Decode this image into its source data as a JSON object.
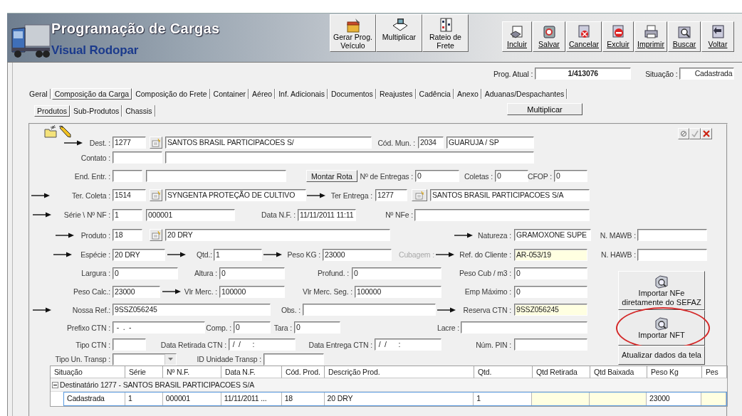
{
  "window": {
    "title": "Programação de Cargas",
    "subtitle": "Visual Rodopar"
  },
  "toolbar_left": [
    {
      "label": "Gerar Prog. Veículo",
      "kind": "generate"
    },
    {
      "label": "Multiplicar",
      "kind": "multiply"
    },
    {
      "label": "Rateio de Frete",
      "kind": "split"
    }
  ],
  "toolbar_right": [
    {
      "label": "Incluir",
      "kind": "insert"
    },
    {
      "label": "Salvar",
      "kind": "save"
    },
    {
      "label": "Cancelar",
      "kind": "cancel"
    },
    {
      "label": "Excluir",
      "kind": "delete"
    },
    {
      "label": "Imprimir",
      "kind": "print"
    },
    {
      "label": "Buscar",
      "kind": "search"
    },
    {
      "label": "Voltar",
      "kind": "back"
    }
  ],
  "record": {
    "prog_label": "Prog. Atual :",
    "prog_value": "1/413076",
    "status_label": "Situação :",
    "status_value": "Cadastrada"
  },
  "tabs": [
    {
      "label": "Geral",
      "selected": false
    },
    {
      "label": "Composição da Carga",
      "selected": true
    },
    {
      "label": "Composição do Frete",
      "selected": false
    },
    {
      "label": "Container",
      "selected": false
    },
    {
      "label": "Aéreo",
      "selected": false
    },
    {
      "label": "Inf. Adicionais",
      "selected": false
    },
    {
      "label": "Documentos",
      "selected": false
    },
    {
      "label": "Reajustes",
      "selected": false
    },
    {
      "label": "Cadência",
      "selected": false
    },
    {
      "label": "Anexo",
      "selected": false
    },
    {
      "label": "Aduanas/Despachantes",
      "selected": false
    }
  ],
  "subtabs": [
    {
      "label": "Produtos",
      "selected": true
    },
    {
      "label": "Sub-Produtos",
      "selected": false
    },
    {
      "label": "Chassis",
      "selected": false
    }
  ],
  "multiply_button": "Multiplicar",
  "form_tools": [
    {
      "kind": "new"
    },
    {
      "kind": "edit"
    }
  ],
  "panel_actions": [
    {
      "kind": "clear",
      "disabled": false
    },
    {
      "kind": "confirm",
      "disabled": true
    },
    {
      "kind": "remove",
      "disabled": false
    }
  ],
  "form": {
    "rows": [
      [
        {
          "kind": "label",
          "text": "Dest. :",
          "arrow": true,
          "disabled": false
        },
        {
          "kind": "field",
          "value": "1277",
          "highlighted": false
        },
        {
          "kind": "lookup"
        },
        {
          "kind": "field",
          "value": "SANTOS BRASIL PARTICIPACOES S/",
          "highlighted": false
        },
        {
          "kind": "label",
          "text": "Cód. Mun. :",
          "arrow": false,
          "disabled": false
        },
        {
          "kind": "field",
          "value": "2034",
          "highlighted": false
        },
        {
          "kind": "field",
          "value": "GUARUJA / SP",
          "highlighted": false
        }
      ],
      [
        {
          "kind": "label",
          "text": "Contato :",
          "arrow": false,
          "disabled": false
        },
        {
          "kind": "field",
          "highlighted": false
        },
        {
          "kind": "field",
          "highlighted": false
        }
      ],
      [
        {
          "kind": "label",
          "text": "End. Entr. :",
          "arrow": false,
          "disabled": false
        },
        {
          "kind": "field",
          "highlighted": false
        },
        {
          "kind": "field",
          "highlighted": false
        },
        {
          "kind": "button",
          "label": "Montar Rota"
        },
        {
          "kind": "label",
          "text": "Nº de Entregas :",
          "arrow": false,
          "disabled": false
        },
        {
          "kind": "field",
          "value": "0",
          "highlighted": false
        },
        {
          "kind": "label",
          "text": "Coletas :",
          "arrow": false,
          "disabled": false
        },
        {
          "kind": "field",
          "value": "0",
          "highlighted": false
        },
        {
          "kind": "label",
          "text": "CFOP :",
          "arrow": false,
          "disabled": false
        },
        {
          "kind": "field",
          "value": "0",
          "highlighted": false
        }
      ],
      [
        {
          "kind": "label",
          "text": "Ter. Coleta :",
          "arrow": true,
          "disabled": false
        },
        {
          "kind": "field",
          "value": "1514",
          "highlighted": false
        },
        {
          "kind": "lookup"
        },
        {
          "kind": "field",
          "value": "SYNGENTA PROTEÇÃO DE CULTIVO",
          "highlighted": false
        },
        {
          "kind": "label",
          "text": "Ter Entrega :",
          "arrow": true,
          "disabled": false
        },
        {
          "kind": "field",
          "value": "1277",
          "highlighted": false
        },
        {
          "kind": "lookup"
        },
        {
          "kind": "field",
          "value": "SANTOS BRASIL PARTICIPACOES S/A",
          "highlighted": false
        }
      ],
      [
        {
          "kind": "label",
          "text": "Série \\ Nº NF :",
          "arrow": true,
          "disabled": false
        },
        {
          "kind": "field",
          "value": "1",
          "highlighted": false
        },
        {
          "kind": "field",
          "value": "000001",
          "highlighted": false
        },
        {
          "kind": "label",
          "text": "Data N.F. :",
          "arrow": false,
          "disabled": false
        },
        {
          "kind": "field",
          "value": "11/11/2011 11:11",
          "highlighted": false
        },
        {
          "kind": "label",
          "text": "Nº NFe :",
          "arrow": false,
          "disabled": false
        },
        {
          "kind": "field",
          "highlighted": false
        }
      ],
      [
        {
          "kind": "label",
          "text": "Produto :",
          "arrow": true,
          "disabled": false
        },
        {
          "kind": "field",
          "value": "18",
          "highlighted": false
        },
        {
          "kind": "lookup"
        },
        {
          "kind": "field",
          "value": "20 DRY",
          "highlighted": false
        },
        {
          "kind": "label",
          "text": "Natureza :",
          "arrow": true,
          "disabled": false
        },
        {
          "kind": "field",
          "value": "GRAMOXONE SUPE",
          "highlighted": false
        },
        {
          "kind": "label",
          "text": "N. MAWB :",
          "arrow": false,
          "disabled": false
        },
        {
          "kind": "field",
          "highlighted": false
        }
      ],
      [
        {
          "kind": "label",
          "text": "Espécie :",
          "arrow": true,
          "disabled": false
        },
        {
          "kind": "field",
          "value": "20 DRY",
          "highlighted": false
        },
        {
          "kind": "label",
          "text": "Qtd.:",
          "arrow": true,
          "disabled": false
        },
        {
          "kind": "field",
          "value": "1",
          "highlighted": false
        },
        {
          "kind": "label",
          "text": "Peso KG :",
          "arrow": true,
          "disabled": false
        },
        {
          "kind": "field",
          "value": "23000",
          "highlighted": false
        },
        {
          "kind": "label",
          "text": "Cubagem :",
          "arrow": false,
          "disabled": true
        },
        {
          "kind": "label",
          "text": "Ref. do Cliente :",
          "arrow": true,
          "disabled": false
        },
        {
          "kind": "field",
          "value": "AR-053/19",
          "highlighted": true
        },
        {
          "kind": "label",
          "text": "N. HAWB :",
          "arrow": false,
          "disabled": false
        },
        {
          "kind": "field",
          "highlighted": false
        }
      ],
      [
        {
          "kind": "label",
          "text": "Largura :",
          "arrow": false,
          "disabled": false
        },
        {
          "kind": "field",
          "value": "0",
          "highlighted": false
        },
        {
          "kind": "label",
          "text": "Altura :",
          "arrow": false,
          "disabled": false
        },
        {
          "kind": "field",
          "value": "0",
          "highlighted": false
        },
        {
          "kind": "label",
          "text": "Profund. :",
          "arrow": false,
          "disabled": false
        },
        {
          "kind": "field",
          "value": "0",
          "highlighted": false
        },
        {
          "kind": "label",
          "text": "Peso Cub / m3 :",
          "arrow": false,
          "disabled": false
        },
        {
          "kind": "field",
          "value": "0",
          "highlighted": false
        }
      ],
      [
        {
          "kind": "label",
          "text": "Peso Calc.:",
          "arrow": false,
          "disabled": false
        },
        {
          "kind": "field",
          "value": "23000",
          "highlighted": false
        },
        {
          "kind": "label",
          "text": "Vlr Merc. :",
          "arrow": true,
          "disabled": false
        },
        {
          "kind": "field",
          "value": "100000",
          "highlighted": false
        },
        {
          "kind": "label",
          "text": "Vlr Merc. Seg. :",
          "arrow": false,
          "disabled": false
        },
        {
          "kind": "field",
          "value": "100000",
          "highlighted": false
        },
        {
          "kind": "label",
          "text": "Emp Máximo :",
          "arrow": false,
          "disabled": false
        },
        {
          "kind": "field",
          "value": "0",
          "highlighted": false
        }
      ],
      [
        {
          "kind": "label",
          "text": "Nossa Ref.:",
          "arrow": true,
          "disabled": false
        },
        {
          "kind": "field",
          "value": "9SSZ056245",
          "highlighted": false
        },
        {
          "kind": "label",
          "text": "Obs. :",
          "arrow": false,
          "disabled": false
        },
        {
          "kind": "field",
          "highlighted": false
        },
        {
          "kind": "label",
          "text": "Reserva CTN :",
          "arrow": true,
          "disabled": false
        },
        {
          "kind": "field",
          "value": "9SSZ056245",
          "highlighted": true
        }
      ],
      [
        {
          "kind": "label",
          "text": "Prefixo CTN :",
          "arrow": false,
          "disabled": false
        },
        {
          "kind": "field",
          "value": " -  .  -",
          "highlighted": false
        },
        {
          "kind": "label",
          "text": "Comp. :",
          "arrow": false,
          "disabled": false
        },
        {
          "kind": "field",
          "value": "0",
          "highlighted": false
        },
        {
          "kind": "label",
          "text": "Tara :",
          "arrow": false,
          "disabled": false
        },
        {
          "kind": "field",
          "value": "0",
          "highlighted": false
        },
        {
          "kind": "label",
          "text": "Lacre :",
          "arrow": false,
          "disabled": false
        },
        {
          "kind": "field",
          "highlighted": false
        }
      ],
      [
        {
          "kind": "label",
          "text": "Tipo CTN :",
          "arrow": false,
          "disabled": false
        },
        {
          "kind": "field",
          "highlighted": false
        },
        {
          "kind": "label",
          "text": "Data Retirada CTN :",
          "arrow": false,
          "disabled": false
        },
        {
          "kind": "field",
          "value": " /  /      :",
          "highlighted": false
        },
        {
          "kind": "label",
          "text": "Data Entrega CTN :",
          "arrow": false,
          "disabled": false
        },
        {
          "kind": "field",
          "value": " /  /      :",
          "highlighted": false
        },
        {
          "kind": "label",
          "text": "Núm. PIN :",
          "arrow": false,
          "disabled": false
        },
        {
          "kind": "field",
          "highlighted": false
        }
      ],
      [
        {
          "kind": "label",
          "text": "Tipo Un. Transp :",
          "arrow": false,
          "disabled": false
        },
        {
          "kind": "select"
        },
        {
          "kind": "label",
          "text": "ID Unidade Transp :",
          "arrow": false,
          "disabled": false
        },
        {
          "kind": "field",
          "highlighted": false
        }
      ]
    ]
  },
  "import_buttons": [
    {
      "label": "Importar NFe diretamente do SEFAZ",
      "kind": "icon",
      "circled": false
    },
    {
      "label": "Importar NFT",
      "kind": "icon",
      "circled": true
    },
    {
      "label": "Atualizar dados da tela",
      "kind": "text",
      "circled": false
    }
  ],
  "table": {
    "columns": [
      {
        "label": "Situação",
        "highlighted": false
      },
      {
        "label": "Série",
        "highlighted": false
      },
      {
        "label": "Nº N.F.",
        "highlighted": false
      },
      {
        "label": "Data N.F.",
        "highlighted": false
      },
      {
        "label": "Cód. Prod.",
        "highlighted": false
      },
      {
        "label": "Descrição Prod.",
        "highlighted": false
      },
      {
        "label": "Qtd.",
        "highlighted": false
      },
      {
        "label": "Qtd Retirada",
        "highlighted": true
      },
      {
        "label": "Qtd Baixada",
        "highlighted": true
      },
      {
        "label": "Peso Kg",
        "highlighted": false
      },
      {
        "label": "Pes",
        "highlighted": true
      }
    ],
    "groups": [
      {
        "label": "Destinatário 1277 - SANTOS BRASIL PARTICIPACOES S/A",
        "expanded": true,
        "rows": [
          {
            "selected": true,
            "cells": [
              "Cadastrada",
              "1",
              "000001",
              "11/11/2011 ...",
              "18",
              "20 DRY",
              "1",
              "",
              "",
              "23000",
              ""
            ]
          }
        ]
      }
    ]
  }
}
